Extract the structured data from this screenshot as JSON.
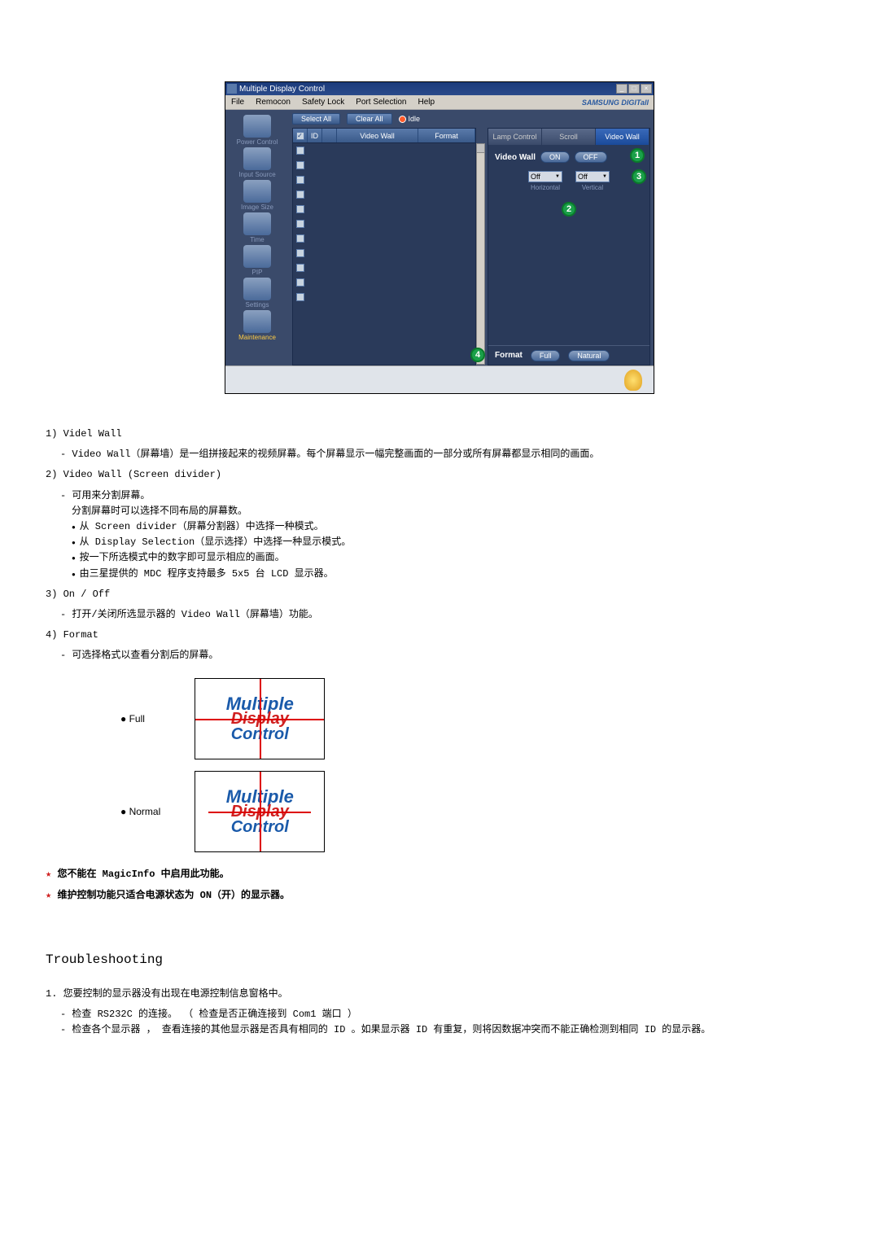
{
  "window": {
    "title": "Multiple Display Control",
    "brand": "SAMSUNG DIGITall"
  },
  "menubar": {
    "file": "File",
    "remocon": "Remocon",
    "safety_lock": "Safety Lock",
    "port_selection": "Port Selection",
    "help": "Help"
  },
  "sidebar": {
    "power": "Power Control",
    "input": "Input Source",
    "image": "Image Size",
    "time": "Time",
    "pip": "PIP",
    "settings": "Settings",
    "maintenance": "Maintenance"
  },
  "toolbar": {
    "select_all": "Select All",
    "clear_all": "Clear All",
    "idle": "Idle"
  },
  "table": {
    "h_id": "ID",
    "h_vw": "Video Wall",
    "h_fmt": "Format",
    "rows": 11
  },
  "tabs": {
    "lamp": "Lamp Control",
    "scroll": "Scroll",
    "videowall": "Video Wall"
  },
  "panel": {
    "vw_label": "Video Wall",
    "on": "ON",
    "off": "OFF",
    "combo_h": "Off",
    "combo_v": "Off",
    "combo_h_label": "Horizontal",
    "combo_v_label": "Vertical",
    "format_label": "Format",
    "full": "Full",
    "natural": "Natural"
  },
  "callouts": {
    "c1": "1",
    "c2": "2",
    "c3": "3",
    "c4": "4"
  },
  "doc": {
    "s1_title": "1) Videl Wall",
    "s1_1": "Video Wall（屏幕墙）是一组拼接起来的视频屏幕。每个屏幕显示一幅完整画面的一部分或所有屏幕都显示相同的画面。",
    "s2_title": "2) Video Wall (Screen divider)",
    "s2_1": "可用来分割屏幕。",
    "s2_2": "分割屏幕时可以选择不同布局的屏幕数。",
    "s2_b1": "从 Screen divider（屏幕分割器）中选择一种模式。",
    "s2_b2": "从 Display Selection（显示选择）中选择一种显示模式。",
    "s2_b3": "按一下所选模式中的数字即可显示相应的画面。",
    "s2_b4": "由三星提供的 MDC 程序支持最多 5x5 台 LCD 显示器。",
    "s3_title": "3) On / Off",
    "s3_1": "打开/关闭所选显示器的 Video Wall（屏幕墙）功能。",
    "s4_title": "4) Format",
    "s4_1": "可选择格式以查看分割后的屏幕。",
    "fmt_full_label": "Full",
    "fmt_normal_label": "Normal",
    "logo_l1": "Multiple",
    "logo_l2": "Display",
    "logo_l3": "Control",
    "star1": "您不能在 MagicInfo 中启用此功能。",
    "star2": "维护控制功能只适合电源状态为 ON（开）的显示器。",
    "troubleshooting": "Troubleshooting",
    "t1_num": "1.",
    "t1": "您要控制的显示器没有出现在电源控制信息窗格中。",
    "t1_b1": "检查 RS232C 的连接。 （ 检查是否正确连接到 Com1 端口 ）",
    "t1_b2": "检查各个显示器 ， 查看连接的其他显示器是否具有相同的 ID 。如果显示器 ID 有重复，则将因数据冲突而不能正确检测到相同 ID 的显示器。"
  }
}
